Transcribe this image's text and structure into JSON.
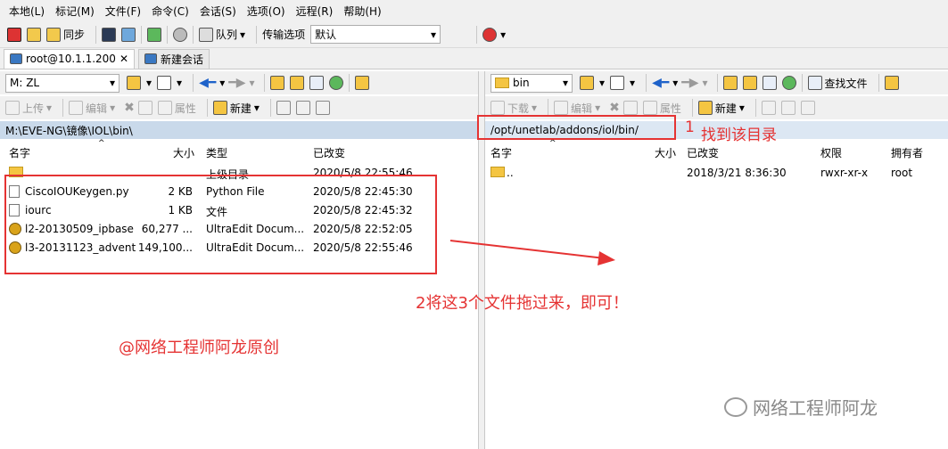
{
  "menu": [
    "本地(L)",
    "标记(M)",
    "文件(F)",
    "命令(C)",
    "会话(S)",
    "选项(O)",
    "远程(R)",
    "帮助(H)"
  ],
  "toolbar": {
    "sync": "同步",
    "queue": "队列",
    "transfer_options": "传输选项",
    "transfer_value": "默认"
  },
  "tabs": [
    {
      "label": "root@10.1.1.200"
    },
    {
      "label": "新建会话"
    }
  ],
  "left": {
    "drive": "M: ZL",
    "upload": "上传",
    "edit": "编辑",
    "props": "属性",
    "new": "新建",
    "path": "M:\\EVE-NG\\镜像\\IOL\\bin\\",
    "headers": {
      "name": "名字",
      "size": "大小",
      "type": "类型",
      "modified": "已改变"
    },
    "rows": [
      {
        "name": "..",
        "size": "",
        "type": "上级目录",
        "modified": "2020/5/8  22:55:46"
      },
      {
        "name": "CiscoIOUKeygen.py",
        "size": "2 KB",
        "type": "Python File",
        "modified": "2020/5/8  22:45:30"
      },
      {
        "name": "iourc",
        "size": "1 KB",
        "type": "文件",
        "modified": "2020/5/8  22:45:32"
      },
      {
        "name": "l2-20130509_ipbase...",
        "size": "60,277 ...",
        "type": "UltraEdit Docum...",
        "modified": "2020/5/8  22:52:05"
      },
      {
        "name": "l3-20131123_advent...",
        "size": "149,100...",
        "type": "UltraEdit Docum...",
        "modified": "2020/5/8  22:55:46"
      }
    ]
  },
  "right": {
    "folder": "bin",
    "download": "下载",
    "edit": "编辑",
    "props": "属性",
    "new": "新建",
    "find": "查找文件",
    "path": "/opt/unetlab/addons/iol/bin/",
    "headers": {
      "name": "名字",
      "size": "大小",
      "modified": "已改变",
      "perm": "权限",
      "owner": "拥有者"
    },
    "rows": [
      {
        "name": "..",
        "size": "",
        "modified": "2018/3/21 8:36:30",
        "perm": "rwxr-xr-x",
        "owner": "root"
      }
    ]
  },
  "annotations": {
    "step1_num": "1",
    "step1_text": "找到该目录",
    "step2_text": "2将这3个文件拖过来，即可！",
    "credit": "@网络工程师阿龙原创",
    "watermark": "网络工程师阿龙"
  },
  "colors": {
    "accent_red": "#e53333",
    "path_bar": "#c9d9ea"
  }
}
